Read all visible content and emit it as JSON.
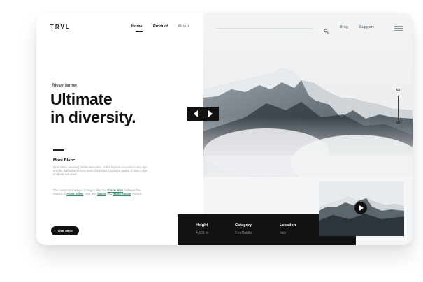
{
  "brand": {
    "logo": "TRVL"
  },
  "nav": {
    "items": [
      "Home",
      "Product",
      "About"
    ],
    "active": "Home",
    "right_items": [
      "Blog",
      "Support"
    ]
  },
  "hero": {
    "eyebrow": "Rieserferner",
    "heading_line1": "Ultimate",
    "heading_line2": "in diversity."
  },
  "slides": {
    "current": "01",
    "total": "04"
  },
  "content": {
    "subtitle": "Mont Blanc",
    "paragraph1": "Mont Blanc meaning \"White Mountain\", is the highest mountain in the Alps and the highest in Europe west of Russia's Caucasus peaks. It rises 4,808 m above sea level.",
    "paragraph2_parts": [
      "The mountain stands in a range called the ",
      "Graian Alps",
      ", between the regions of ",
      "Aosta Valley",
      ", Italy, and ",
      "Savoie",
      " and ",
      "Haute-Savoie",
      ", France."
    ],
    "cta_label": "View More"
  },
  "stats": {
    "items": [
      {
        "label": "Height",
        "value": "4,808 m"
      },
      {
        "label": "Category",
        "value": "9 in Middle"
      },
      {
        "label": "Location",
        "value": "Italy"
      }
    ]
  },
  "colors": {
    "accent": "#111111",
    "link": "#3a8a73",
    "background": "#ffffff"
  },
  "icons": [
    "search-icon",
    "menu-icon",
    "arrow-left-icon",
    "arrow-right-icon",
    "play-icon"
  ]
}
